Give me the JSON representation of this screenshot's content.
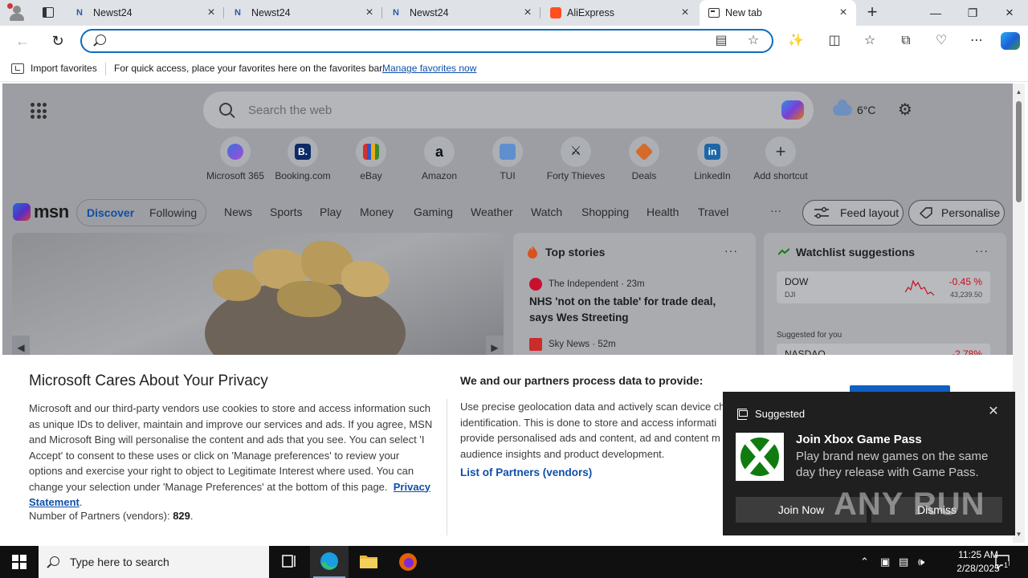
{
  "browser": {
    "tabs": [
      {
        "title": "Newst24",
        "favicon": "newst24-icon"
      },
      {
        "title": "Newst24",
        "favicon": "newst24-icon"
      },
      {
        "title": "Newst24",
        "favicon": "newst24-icon"
      },
      {
        "title": "AliExpress",
        "favicon": "aliexpress-icon"
      },
      {
        "title": "New tab",
        "favicon": "new-tab-icon",
        "active": true
      }
    ],
    "address": {
      "value": "",
      "placeholder": ""
    },
    "favorites_bar": {
      "import_label": "Import favorites",
      "hint": "For quick access, place your favorites here on the favorites bar.",
      "manage_link": "Manage favorites now"
    }
  },
  "msn": {
    "search_placeholder": "Search the web",
    "weather": {
      "temp": "6°C",
      "icon": "cloud-icon"
    },
    "shortcuts": [
      {
        "label": "Microsoft 365",
        "icon": "microsoft365-icon"
      },
      {
        "label": "Booking.com",
        "icon": "booking-icon",
        "glyph": "B."
      },
      {
        "label": "eBay",
        "icon": "ebay-icon"
      },
      {
        "label": "Amazon",
        "icon": "amazon-icon",
        "glyph": "a"
      },
      {
        "label": "TUI",
        "icon": "tui-icon"
      },
      {
        "label": "Forty Thieves",
        "icon": "forty-thieves-icon"
      },
      {
        "label": "Deals",
        "icon": "deals-icon"
      },
      {
        "label": "LinkedIn",
        "icon": "linkedin-icon",
        "glyph": "in"
      },
      {
        "label": "Add shortcut",
        "icon": "plus-icon",
        "glyph": "+"
      }
    ],
    "feed_tabs": {
      "discover": "Discover",
      "following": "Following"
    },
    "categories": [
      "News",
      "Sports",
      "Play",
      "Money",
      "Gaming",
      "Weather",
      "Watch",
      "Shopping",
      "Health",
      "Travel"
    ],
    "more": "···",
    "feed_layout": "Feed layout",
    "personalise": "Personalise",
    "top_stories": {
      "header": "Top stories",
      "items": [
        {
          "source": "The Independent · 23m",
          "title": "NHS 'not on the table' for trade deal, says Wes Streeting"
        },
        {
          "source": "Sky News · 52m"
        }
      ]
    },
    "watchlist": {
      "header": "Watchlist suggestions",
      "rows": [
        {
          "symbol": "DOW",
          "sub": "DJI",
          "change": "-0.45 %",
          "value": "43,239.50"
        }
      ],
      "suggested_label": "Suggested for you",
      "suggested": [
        {
          "symbol": "NASDAQ",
          "change": "-2.78%"
        }
      ]
    }
  },
  "privacy": {
    "title": "Microsoft Cares About Your Privacy",
    "body": "Microsoft and our third-party vendors use cookies to store and access information such as unique IDs to deliver, maintain and improve our services and ads. If you agree, MSN and Microsoft Bing will personalise the content and ads that you see. You can select 'I Accept' to consent to these uses or click on 'Manage preferences' to review your options and exercise your right to object to Legitimate Interest where used.  You can change your selection under 'Manage Preferences' at the bottom of this page.",
    "privacy_link": "Privacy Statement",
    "partners_label": "Number of Partners (vendors):",
    "partners_count": "829",
    "partners_suffix": ".",
    "process_title": "We and our partners process data to provide:",
    "process_lines": [
      "Use precise geolocation data and actively scan device ch",
      "identification. This is done to store and access informati",
      "provide personalised ads and content, ad and content m",
      "audience insights and product development."
    ],
    "list_link": "List of Partners (vendors)"
  },
  "toast": {
    "label": "Suggested",
    "title": "Join Xbox Game Pass",
    "description": "Play brand new games on the same day they release with Game Pass.",
    "join": "Join Now",
    "dismiss": "Dismiss",
    "watermark": "ANY  RUN"
  },
  "taskbar": {
    "search_placeholder": "Type here to search",
    "time": "11:25 AM",
    "date": "2/28/2025",
    "notification_count": "1"
  }
}
